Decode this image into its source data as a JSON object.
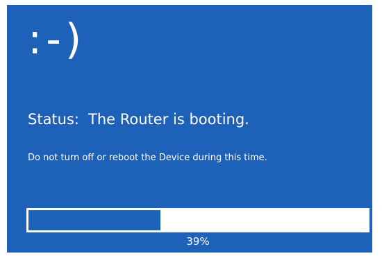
{
  "screen": {
    "background_color": "#1d62b8",
    "emoticon": ":-)",
    "status_label": "Status:",
    "status_text": "The Router is booting.",
    "warning": "Do not turn off or reboot the Device during this time.",
    "progress": {
      "value_percent": 39,
      "label": "39%"
    }
  }
}
